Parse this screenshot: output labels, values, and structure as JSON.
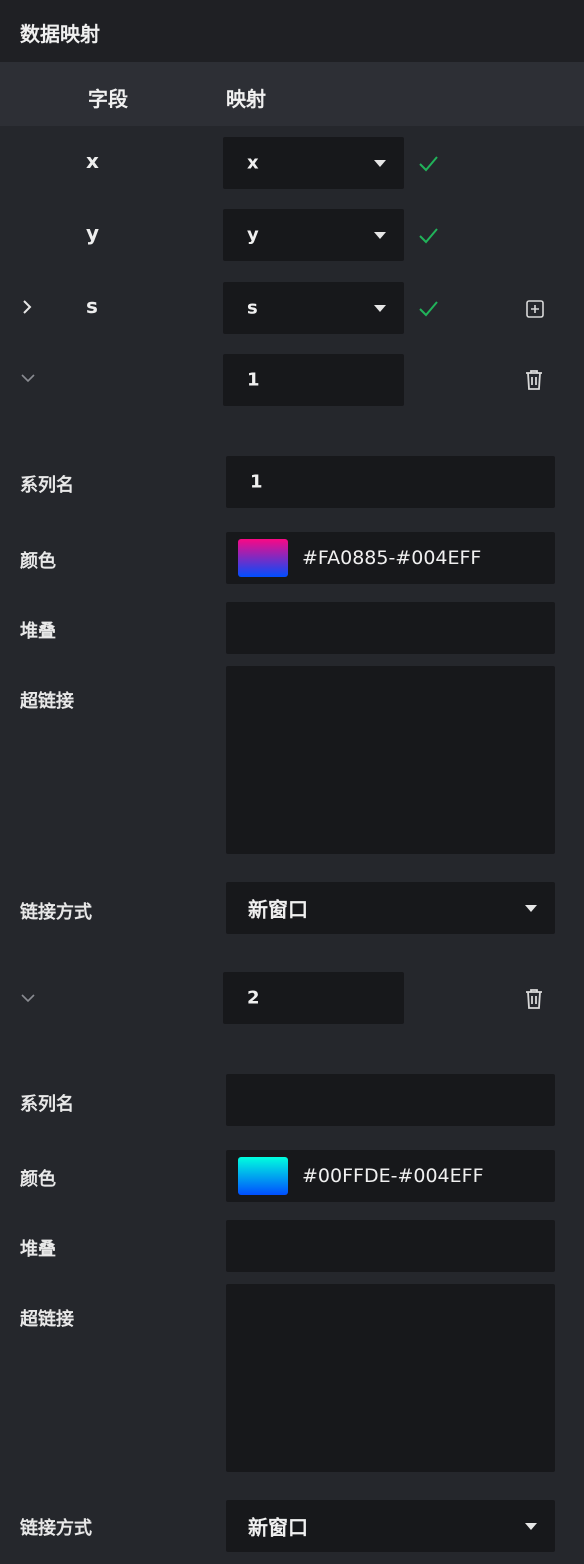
{
  "panel": {
    "title": "数据映射"
  },
  "header": {
    "field": "字段",
    "mapping": "映射"
  },
  "mappings": [
    {
      "field": "x",
      "value": "x"
    },
    {
      "field": "y",
      "value": "y"
    },
    {
      "field": "s",
      "value": "s"
    }
  ],
  "series": [
    {
      "id": "1",
      "name_label": "系列名",
      "name_value": "1",
      "color_label": "颜色",
      "color_value": "#FA0885-#004EFF",
      "color_from": "#FA0885",
      "color_to": "#004EFF",
      "stack_label": "堆叠",
      "stack_value": "",
      "link_label": "超链接",
      "link_value": "",
      "link_mode_label": "链接方式",
      "link_mode_value": "新窗口"
    },
    {
      "id": "2",
      "name_label": "系列名",
      "name_value": "",
      "color_label": "颜色",
      "color_value": "#00FFDE-#004EFF",
      "color_from": "#00FFDE",
      "color_to": "#004EFF",
      "stack_label": "堆叠",
      "stack_value": "",
      "link_label": "超链接",
      "link_value": "",
      "link_mode_label": "链接方式",
      "link_mode_value": "新窗口"
    }
  ],
  "colors": {
    "check": "#21b35a",
    "background": "#25272c",
    "input": "#17181b"
  }
}
